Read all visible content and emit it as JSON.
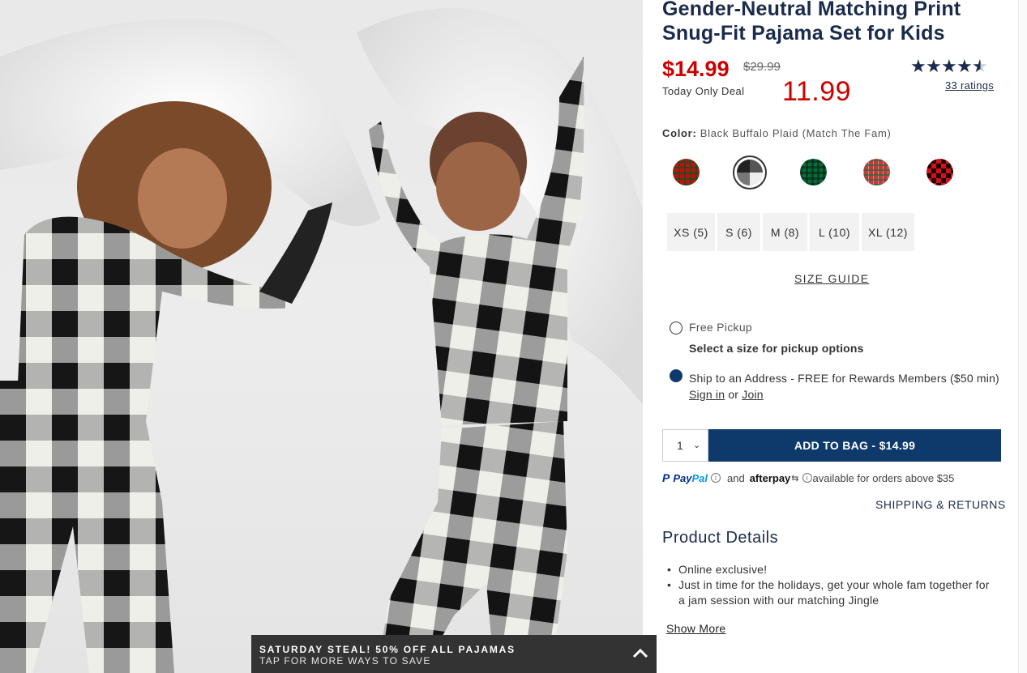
{
  "product": {
    "title": "Gender-Neutral Matching Print Snug-Fit Pajama Set for Kids",
    "sale_price": "$14.99",
    "original_price": "$29.99",
    "deal_label": "Today Only Deal",
    "deal_price": "11.99",
    "rating": 4.5,
    "ratings_text": "33 ratings",
    "star_glyph": "★"
  },
  "color": {
    "label": "Color:",
    "value": "Black Buffalo Plaid (Match The Fam)",
    "swatches": [
      "red-plaid",
      "black-buffalo-plaid",
      "green-plaid",
      "red-tartan",
      "red-buffalo-plaid"
    ],
    "selected": "black-buffalo-plaid"
  },
  "sizes": [
    "XS (5)",
    "S (6)",
    "M (8)",
    "L (10)",
    "XL (12)"
  ],
  "size_guide": "SIZE GUIDE",
  "fulfillment": {
    "pickup_label": "Free Pickup",
    "pickup_sub": "Select a size for pickup options",
    "ship_label": "Ship to an Address - FREE for Rewards Members ($50 min)",
    "sign_in": "Sign in",
    "or": "or",
    "join": "Join"
  },
  "cart": {
    "quantity": "1",
    "add_label": "ADD TO BAG  -  $14.99"
  },
  "payments": {
    "paypal_p": "P",
    "paypal_word1": "Pay",
    "paypal_word2": "Pal",
    "and": "and",
    "afterpay": "afterpay",
    "note": "available for orders above $35"
  },
  "shipping_returns": "SHIPPING & RETURNS",
  "details": {
    "heading": "Product Details",
    "items": [
      "Online exclusive!",
      "Just in time for the holidays, get your whole fam together for a jam session with our matching Jingle"
    ],
    "show_more": "Show More"
  },
  "promo": {
    "title": "SATURDAY STEAL! 50% OFF ALL PAJAMAS",
    "subtitle": "TAP FOR MORE WAYS TO SAVE"
  },
  "colors": {
    "navy": "#1a2b4b",
    "button": "#0e3a6b",
    "sale_red": "#cc0000",
    "banner": "#333333"
  }
}
